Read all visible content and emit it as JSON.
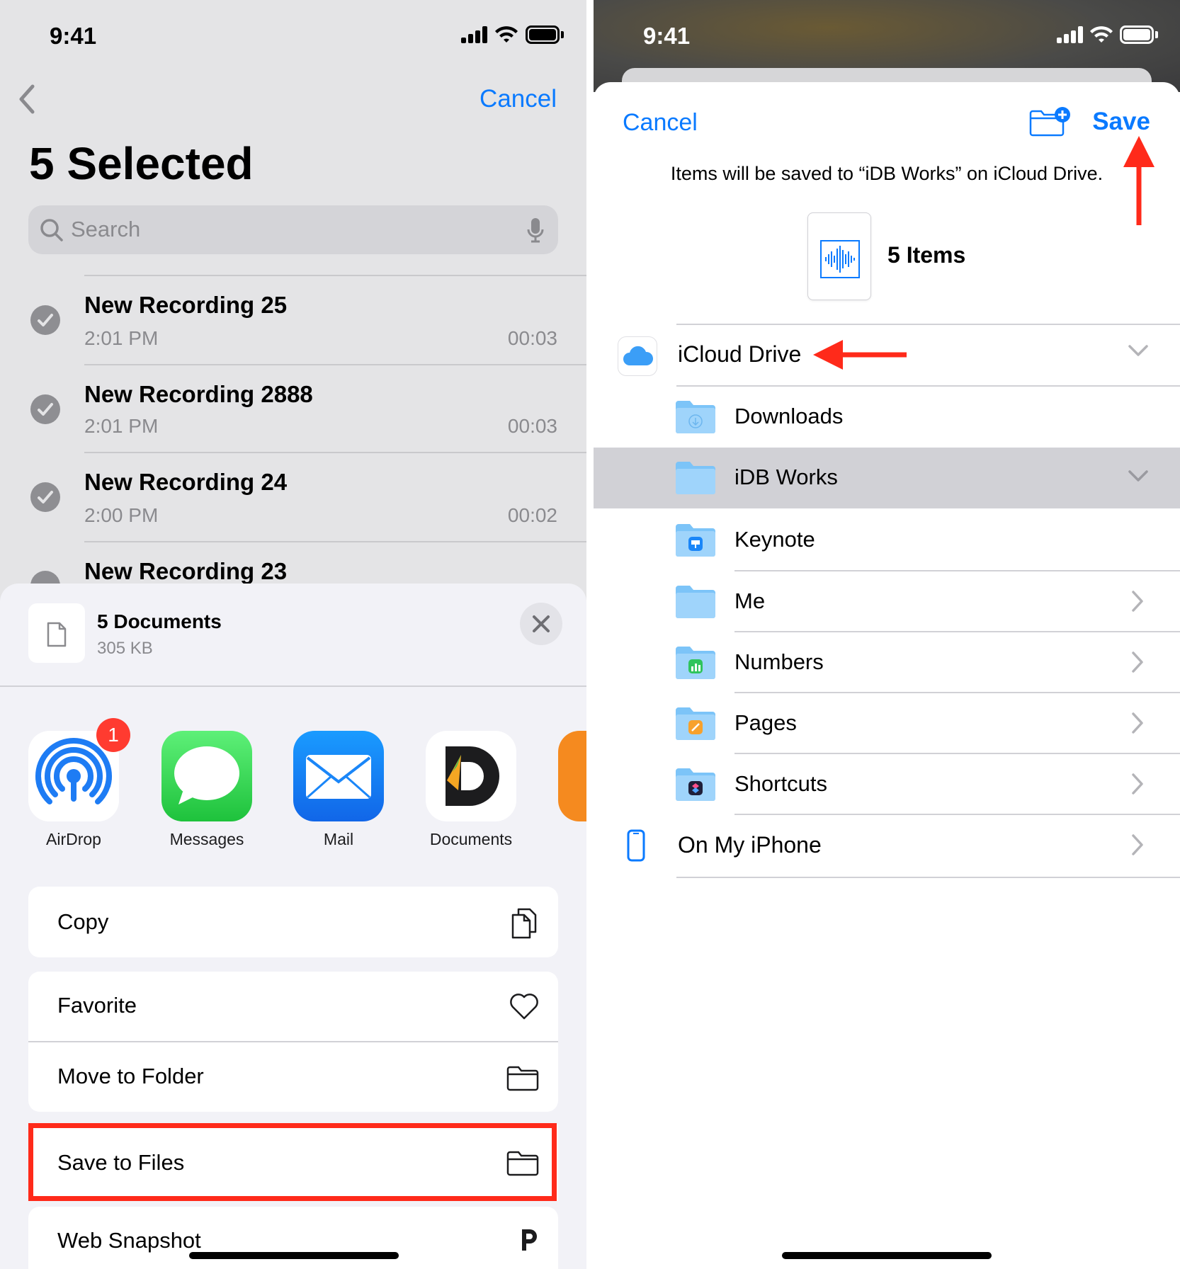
{
  "left": {
    "status": {
      "time": "9:41"
    },
    "nav": {
      "cancel": "Cancel"
    },
    "title": "5 Selected",
    "search": {
      "placeholder": "Search"
    },
    "recordings": [
      {
        "title": "New Recording 25",
        "time": "2:01 PM",
        "duration": "00:03"
      },
      {
        "title": "New Recording 2888",
        "time": "2:01 PM",
        "duration": "00:03"
      },
      {
        "title": "New Recording 24",
        "time": "2:00 PM",
        "duration": "00:02"
      },
      {
        "title": "New Recording 23"
      }
    ],
    "sheet": {
      "doc_title": "5 Documents",
      "doc_size": "305 KB",
      "apps": [
        {
          "label": "AirDrop",
          "badge": "1"
        },
        {
          "label": "Messages"
        },
        {
          "label": "Mail"
        },
        {
          "label": "Documents"
        }
      ],
      "actions": {
        "copy": "Copy",
        "favorite": "Favorite",
        "move": "Move to Folder",
        "save": "Save to Files",
        "snapshot": "Web Snapshot"
      }
    }
  },
  "right": {
    "status": {
      "time": "9:41"
    },
    "cancel": "Cancel",
    "save": "Save",
    "message": "Items will be saved to “iDB Works” on iCloud Drive.",
    "items_label": "5 Items",
    "icloud_label": "iCloud Drive",
    "folders": [
      "Downloads",
      "iDB Works",
      "Keynote",
      "Me",
      "Numbers",
      "Pages",
      "Shortcuts"
    ],
    "on_my_iphone": "On My iPhone"
  },
  "colors": {
    "accent": "#0a7aff",
    "annotation_red": "#ff2a1a",
    "selected_row": "#d1d1d6"
  }
}
